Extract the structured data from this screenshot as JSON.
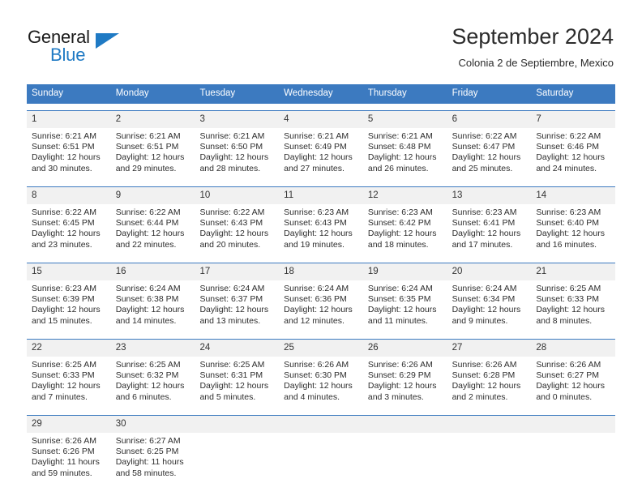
{
  "brand": {
    "name_top": "General",
    "name_bottom": "Blue",
    "logo_color": "#1f7ac4",
    "triangle_icon": "triangle-icon"
  },
  "header": {
    "title": "September 2024",
    "subtitle": "Colonia 2 de Septiembre, Mexico"
  },
  "theme": {
    "header_blue": "#3c7ac0",
    "daynum_band": "#f1f1f1",
    "text": "#2d2d2d"
  },
  "calendar": {
    "weekdays": [
      "Sunday",
      "Monday",
      "Tuesday",
      "Wednesday",
      "Thursday",
      "Friday",
      "Saturday"
    ],
    "weeks": [
      {
        "daynums": [
          "1",
          "2",
          "3",
          "4",
          "5",
          "6",
          "7"
        ],
        "cells": [
          {
            "sunrise": "Sunrise: 6:21 AM",
            "sunset": "Sunset: 6:51 PM",
            "daylight_1": "Daylight: 12 hours",
            "daylight_2": "and 30 minutes."
          },
          {
            "sunrise": "Sunrise: 6:21 AM",
            "sunset": "Sunset: 6:51 PM",
            "daylight_1": "Daylight: 12 hours",
            "daylight_2": "and 29 minutes."
          },
          {
            "sunrise": "Sunrise: 6:21 AM",
            "sunset": "Sunset: 6:50 PM",
            "daylight_1": "Daylight: 12 hours",
            "daylight_2": "and 28 minutes."
          },
          {
            "sunrise": "Sunrise: 6:21 AM",
            "sunset": "Sunset: 6:49 PM",
            "daylight_1": "Daylight: 12 hours",
            "daylight_2": "and 27 minutes."
          },
          {
            "sunrise": "Sunrise: 6:21 AM",
            "sunset": "Sunset: 6:48 PM",
            "daylight_1": "Daylight: 12 hours",
            "daylight_2": "and 26 minutes."
          },
          {
            "sunrise": "Sunrise: 6:22 AM",
            "sunset": "Sunset: 6:47 PM",
            "daylight_1": "Daylight: 12 hours",
            "daylight_2": "and 25 minutes."
          },
          {
            "sunrise": "Sunrise: 6:22 AM",
            "sunset": "Sunset: 6:46 PM",
            "daylight_1": "Daylight: 12 hours",
            "daylight_2": "and 24 minutes."
          }
        ]
      },
      {
        "daynums": [
          "8",
          "9",
          "10",
          "11",
          "12",
          "13",
          "14"
        ],
        "cells": [
          {
            "sunrise": "Sunrise: 6:22 AM",
            "sunset": "Sunset: 6:45 PM",
            "daylight_1": "Daylight: 12 hours",
            "daylight_2": "and 23 minutes."
          },
          {
            "sunrise": "Sunrise: 6:22 AM",
            "sunset": "Sunset: 6:44 PM",
            "daylight_1": "Daylight: 12 hours",
            "daylight_2": "and 22 minutes."
          },
          {
            "sunrise": "Sunrise: 6:22 AM",
            "sunset": "Sunset: 6:43 PM",
            "daylight_1": "Daylight: 12 hours",
            "daylight_2": "and 20 minutes."
          },
          {
            "sunrise": "Sunrise: 6:23 AM",
            "sunset": "Sunset: 6:43 PM",
            "daylight_1": "Daylight: 12 hours",
            "daylight_2": "and 19 minutes."
          },
          {
            "sunrise": "Sunrise: 6:23 AM",
            "sunset": "Sunset: 6:42 PM",
            "daylight_1": "Daylight: 12 hours",
            "daylight_2": "and 18 minutes."
          },
          {
            "sunrise": "Sunrise: 6:23 AM",
            "sunset": "Sunset: 6:41 PM",
            "daylight_1": "Daylight: 12 hours",
            "daylight_2": "and 17 minutes."
          },
          {
            "sunrise": "Sunrise: 6:23 AM",
            "sunset": "Sunset: 6:40 PM",
            "daylight_1": "Daylight: 12 hours",
            "daylight_2": "and 16 minutes."
          }
        ]
      },
      {
        "daynums": [
          "15",
          "16",
          "17",
          "18",
          "19",
          "20",
          "21"
        ],
        "cells": [
          {
            "sunrise": "Sunrise: 6:23 AM",
            "sunset": "Sunset: 6:39 PM",
            "daylight_1": "Daylight: 12 hours",
            "daylight_2": "and 15 minutes."
          },
          {
            "sunrise": "Sunrise: 6:24 AM",
            "sunset": "Sunset: 6:38 PM",
            "daylight_1": "Daylight: 12 hours",
            "daylight_2": "and 14 minutes."
          },
          {
            "sunrise": "Sunrise: 6:24 AM",
            "sunset": "Sunset: 6:37 PM",
            "daylight_1": "Daylight: 12 hours",
            "daylight_2": "and 13 minutes."
          },
          {
            "sunrise": "Sunrise: 6:24 AM",
            "sunset": "Sunset: 6:36 PM",
            "daylight_1": "Daylight: 12 hours",
            "daylight_2": "and 12 minutes."
          },
          {
            "sunrise": "Sunrise: 6:24 AM",
            "sunset": "Sunset: 6:35 PM",
            "daylight_1": "Daylight: 12 hours",
            "daylight_2": "and 11 minutes."
          },
          {
            "sunrise": "Sunrise: 6:24 AM",
            "sunset": "Sunset: 6:34 PM",
            "daylight_1": "Daylight: 12 hours",
            "daylight_2": "and 9 minutes."
          },
          {
            "sunrise": "Sunrise: 6:25 AM",
            "sunset": "Sunset: 6:33 PM",
            "daylight_1": "Daylight: 12 hours",
            "daylight_2": "and 8 minutes."
          }
        ]
      },
      {
        "daynums": [
          "22",
          "23",
          "24",
          "25",
          "26",
          "27",
          "28"
        ],
        "cells": [
          {
            "sunrise": "Sunrise: 6:25 AM",
            "sunset": "Sunset: 6:33 PM",
            "daylight_1": "Daylight: 12 hours",
            "daylight_2": "and 7 minutes."
          },
          {
            "sunrise": "Sunrise: 6:25 AM",
            "sunset": "Sunset: 6:32 PM",
            "daylight_1": "Daylight: 12 hours",
            "daylight_2": "and 6 minutes."
          },
          {
            "sunrise": "Sunrise: 6:25 AM",
            "sunset": "Sunset: 6:31 PM",
            "daylight_1": "Daylight: 12 hours",
            "daylight_2": "and 5 minutes."
          },
          {
            "sunrise": "Sunrise: 6:26 AM",
            "sunset": "Sunset: 6:30 PM",
            "daylight_1": "Daylight: 12 hours",
            "daylight_2": "and 4 minutes."
          },
          {
            "sunrise": "Sunrise: 6:26 AM",
            "sunset": "Sunset: 6:29 PM",
            "daylight_1": "Daylight: 12 hours",
            "daylight_2": "and 3 minutes."
          },
          {
            "sunrise": "Sunrise: 6:26 AM",
            "sunset": "Sunset: 6:28 PM",
            "daylight_1": "Daylight: 12 hours",
            "daylight_2": "and 2 minutes."
          },
          {
            "sunrise": "Sunrise: 6:26 AM",
            "sunset": "Sunset: 6:27 PM",
            "daylight_1": "Daylight: 12 hours",
            "daylight_2": "and 0 minutes."
          }
        ]
      },
      {
        "daynums": [
          "29",
          "30",
          "",
          "",
          "",
          "",
          ""
        ],
        "cells": [
          {
            "sunrise": "Sunrise: 6:26 AM",
            "sunset": "Sunset: 6:26 PM",
            "daylight_1": "Daylight: 11 hours",
            "daylight_2": "and 59 minutes."
          },
          {
            "sunrise": "Sunrise: 6:27 AM",
            "sunset": "Sunset: 6:25 PM",
            "daylight_1": "Daylight: 11 hours",
            "daylight_2": "and 58 minutes."
          },
          {
            "sunrise": "",
            "sunset": "",
            "daylight_1": "",
            "daylight_2": ""
          },
          {
            "sunrise": "",
            "sunset": "",
            "daylight_1": "",
            "daylight_2": ""
          },
          {
            "sunrise": "",
            "sunset": "",
            "daylight_1": "",
            "daylight_2": ""
          },
          {
            "sunrise": "",
            "sunset": "",
            "daylight_1": "",
            "daylight_2": ""
          },
          {
            "sunrise": "",
            "sunset": "",
            "daylight_1": "",
            "daylight_2": ""
          }
        ]
      }
    ]
  }
}
